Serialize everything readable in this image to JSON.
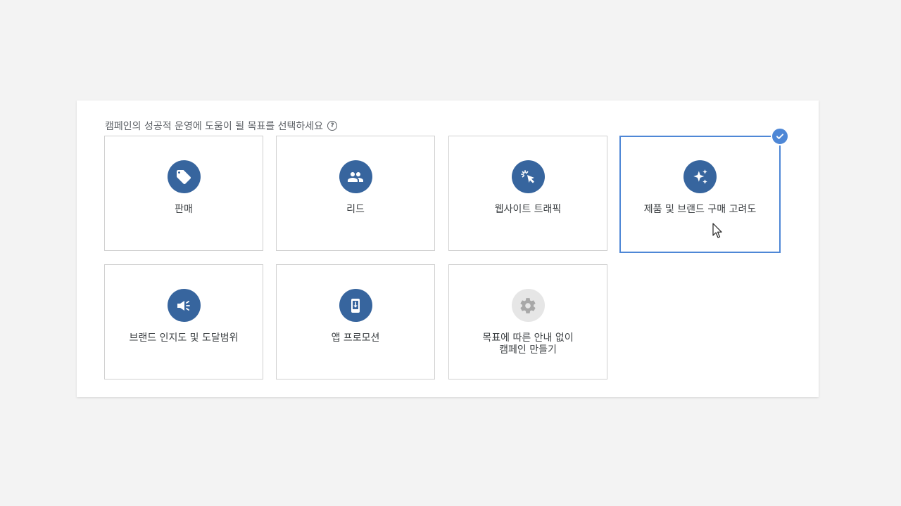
{
  "prompt": {
    "text": "캠페인의 성공적 운영에 도움이 될 목표를 선택하세요",
    "help_icon": "question-circle-icon"
  },
  "goals": [
    {
      "label": "판매",
      "icon": "tag-icon"
    },
    {
      "label": "리드",
      "icon": "people-icon"
    },
    {
      "label": "웹사이트 트래픽",
      "icon": "cursor-click-icon"
    },
    {
      "label": "제품 및 브랜드 구매 고려도",
      "icon": "sparkle-icon",
      "selected": true
    },
    {
      "label": "브랜드 인지도 및 도달범위",
      "icon": "megaphone-icon"
    },
    {
      "label": "앱 프로모션",
      "icon": "phone-download-icon"
    },
    {
      "label": "목표에 따른 안내 없이\n캠페인 만들기",
      "icon": "gear-icon"
    }
  ],
  "colors": {
    "icon_bg": "#37659e",
    "selected_border": "#4e87d6",
    "disabled_icon_bg": "#e6e6e6"
  }
}
